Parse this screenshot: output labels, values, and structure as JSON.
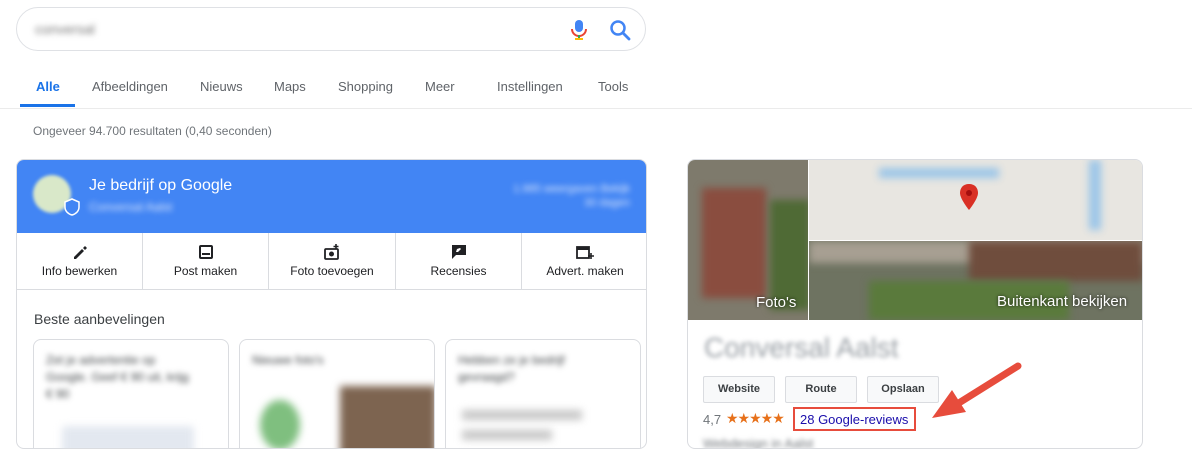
{
  "search": {
    "query": "conversal",
    "mic_icon": "microphone-icon",
    "search_icon": "magnifier-icon"
  },
  "tabs": [
    {
      "label": "Alle",
      "active": true
    },
    {
      "label": "Afbeeldingen"
    },
    {
      "label": "Nieuws"
    },
    {
      "label": "Maps"
    },
    {
      "label": "Shopping"
    },
    {
      "label": "Meer"
    },
    {
      "label": "Instellingen"
    },
    {
      "label": "Tools"
    }
  ],
  "result_stats": "Ongeveer 94.700 resultaten (0,40 seconden)",
  "business": {
    "title": "Je bedrijf op Google",
    "subtitle": "Conversal Aalst",
    "stats": "1.985 weergaven Bekijk 30 dagen",
    "actions": [
      {
        "label": "Info bewerken",
        "icon": "pencil-icon"
      },
      {
        "label": "Post maken",
        "icon": "post-icon"
      },
      {
        "label": "Foto toevoegen",
        "icon": "add-photo-icon"
      },
      {
        "label": "Recensies",
        "icon": "review-icon"
      },
      {
        "label": "Advert. maken",
        "icon": "create-ad-icon"
      }
    ],
    "recommendations_title": "Beste aanbevelingen",
    "recommendations": [
      {
        "text": "Zet je advertentie op Google. Geef € 90 uit, krijg € 90"
      },
      {
        "text": "Nieuwe foto's"
      },
      {
        "text": "Hebben ze je bedrijf gevraagd?"
      }
    ]
  },
  "knowledge_panel": {
    "photos_label": "Foto's",
    "street_label": "Buitenkant bekijken",
    "name": "Conversal Aalst",
    "buttons": [
      "Website",
      "Route",
      "Opslaan"
    ],
    "rating": "4,7",
    "stars": "★★★★★",
    "reviews_link": "28 Google-reviews",
    "type": "Webdesign in Aalst"
  },
  "colors": {
    "accent": "#1a73e8",
    "header_blue": "#4285f4",
    "highlight_red": "#e74c3c",
    "star_orange": "#e7711b"
  }
}
